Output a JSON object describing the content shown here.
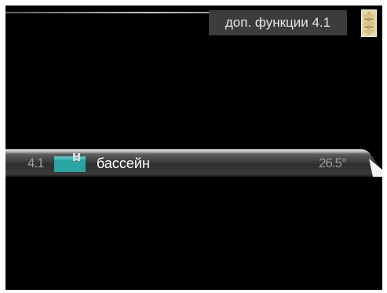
{
  "header": {
    "title": "доп. функции  4.1"
  },
  "icons": {
    "top_right": "pump-settings-icon",
    "menu_item": "pool-icon"
  },
  "menu": {
    "items": [
      {
        "number": "4.1",
        "label": "бассейн",
        "value": "26.5°"
      }
    ]
  },
  "colors": {
    "background": "#000000",
    "header_box": "#3c3c3c",
    "bar_light": "#d6d6d6",
    "bar_dark": "#3a3a3a",
    "pool_icon": "#2aa7a7"
  }
}
